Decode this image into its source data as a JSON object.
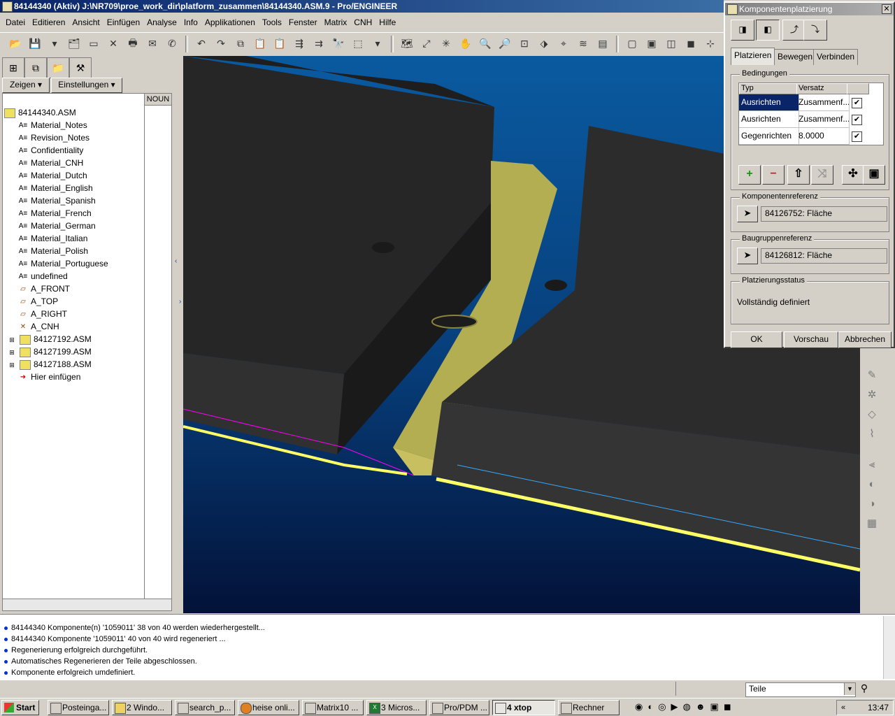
{
  "window": {
    "title": "84144340 (Aktiv) J:\\NR709\\proe_work_dir\\platform_zusammen\\84144340.ASM.9 - Pro/ENGINEER"
  },
  "menu": [
    "Datei",
    "Editieren",
    "Ansicht",
    "Einfügen",
    "Analyse",
    "Info",
    "Applikationen",
    "Tools",
    "Fenster",
    "Matrix",
    "CNH",
    "Hilfe"
  ],
  "model_tree": {
    "show_label": "Zeigen",
    "settings_label": "Einstellungen",
    "column_header": "NOUN",
    "items": [
      {
        "label": "84144340.ASM",
        "icon": "assembly-icon"
      },
      {
        "label": "Material_Notes",
        "icon": "note-icon"
      },
      {
        "label": "Revision_Notes",
        "icon": "note-icon"
      },
      {
        "label": "Confidentiality",
        "icon": "note-icon"
      },
      {
        "label": "Material_CNH",
        "icon": "note-icon"
      },
      {
        "label": "Material_Dutch",
        "icon": "note-icon"
      },
      {
        "label": "Material_English",
        "icon": "note-icon"
      },
      {
        "label": "Material_Spanish",
        "icon": "note-icon"
      },
      {
        "label": "Material_French",
        "icon": "note-icon"
      },
      {
        "label": "Material_German",
        "icon": "note-icon"
      },
      {
        "label": "Material_Italian",
        "icon": "note-icon"
      },
      {
        "label": "Material_Polish",
        "icon": "note-icon"
      },
      {
        "label": "Material_Portuguese",
        "icon": "note-icon"
      },
      {
        "label": "undefined",
        "icon": "note-icon"
      },
      {
        "label": "A_FRONT",
        "icon": "datum-plane-icon"
      },
      {
        "label": "A_TOP",
        "icon": "datum-plane-icon"
      },
      {
        "label": "A_RIGHT",
        "icon": "datum-plane-icon"
      },
      {
        "label": "A_CNH",
        "icon": "coordinate-system-icon"
      },
      {
        "label": "84127192.ASM",
        "icon": "assembly-icon"
      },
      {
        "label": "84127199.ASM",
        "icon": "assembly-icon"
      },
      {
        "label": "84127188.ASM",
        "icon": "assembly-icon"
      },
      {
        "label": "Hier einfügen",
        "icon": "insert-arrow-icon"
      }
    ]
  },
  "dialog": {
    "title": "Komponentenplatzierung",
    "tabs": [
      "Platzieren",
      "Bewegen",
      "Verbinden"
    ],
    "constraints_group": "Bedingungen",
    "table_headers": [
      "Typ",
      "Versatz"
    ],
    "constraints": [
      {
        "type": "Ausrichten",
        "offset": "Zusammenf...",
        "checked": true
      },
      {
        "type": "Ausrichten",
        "offset": "Zusammenf...",
        "checked": true
      },
      {
        "type": "Gegenrichten",
        "offset": "8.0000",
        "checked": true
      }
    ],
    "component_ref_group": "Komponentenreferenz",
    "component_ref_value": "84126752: Fläche",
    "assembly_ref_group": "Baugruppenreferenz",
    "assembly_ref_value": "84126812: Fläche",
    "status_group": "Platzierungsstatus",
    "status_value": "Vollständig definiert",
    "ok_label": "OK",
    "preview_label": "Vorschau",
    "cancel_label": "Abbrechen"
  },
  "messages": [
    "84144340 Komponente(n) '1059011' 38 von 40 werden wiederhergestellt...",
    "84144340 Komponente '1059011' 40 von 40 wird regeneriert ...",
    "Regenerierung erfolgreich durchgeführt.",
    "Automatisches Regenerieren der Teile abgeschlossen.",
    "Komponente erfolgreich umdefiniert."
  ],
  "status": {
    "filter_value": "Teile"
  },
  "taskbar": {
    "start_label": "Start",
    "tasks": [
      "Posteinga...",
      "2 Windo...",
      "search_p...",
      "heise onli...",
      "Matrix10 ...",
      "3 Micros...",
      "Pro/PDM ...",
      "4 xtop",
      "Rechner"
    ],
    "clock": "13:47"
  },
  "colors": {
    "viewport_top": "#0a5aa0",
    "viewport_bottom": "#031238",
    "plate": "#2b2b2b",
    "bracket": "#b4ae52",
    "edge_highlight": "#ffff66",
    "selection_magenta": "#ff00ff",
    "selection_cyan": "#33aaff"
  }
}
